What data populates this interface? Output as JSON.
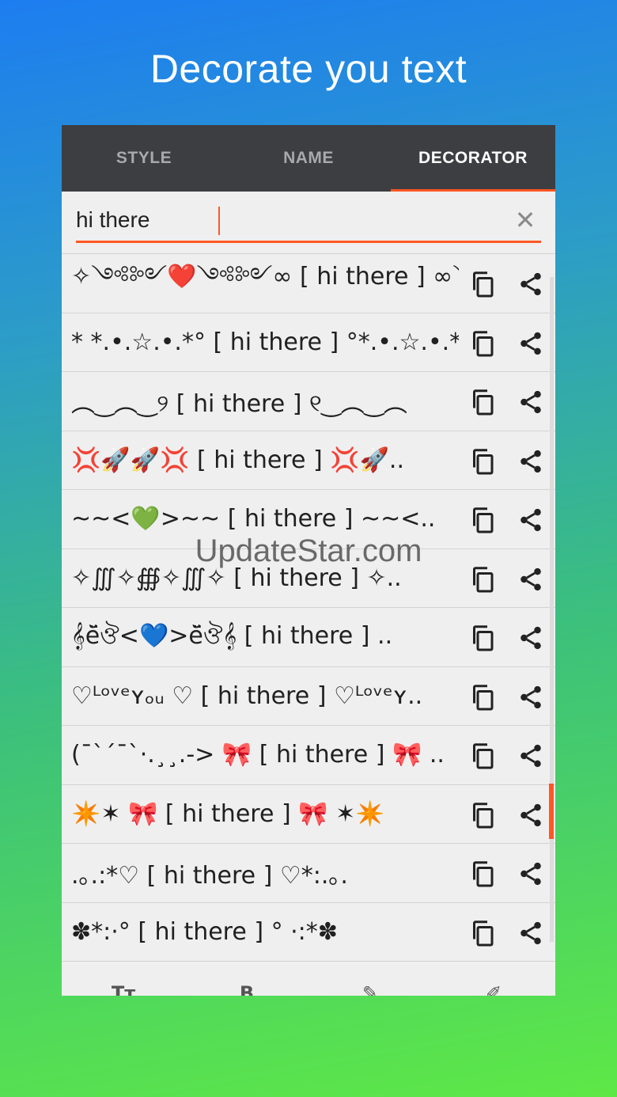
{
  "headline": "Decorate you text",
  "tabs": [
    {
      "label": "STYLE",
      "active": false
    },
    {
      "label": "NAME",
      "active": false
    },
    {
      "label": "DECORATOR",
      "active": true
    }
  ],
  "search": {
    "value": "hi there",
    "clear_icon": "close-icon"
  },
  "rows": [
    "✧༺༻❤️༺༻∞ [ hi there ] ∞༺༻..",
    "* *.•.☆.•.*°  [ hi there ] °*.•.☆.•.*° *",
    "︵‿︵‿୨ [ hi there ] ୧‿︵‿︵",
    "💢🚀🚀💢 [ hi there ] 💢🚀..",
    "~~<💚>~~ [ hi there ] ~~<..",
    "✧∭✧∰✧∭✧ [ hi there ] ✧..",
    "𝄞ĕ̈ঔ<💙>ĕ̈ঔ𝄞 [ hi there ] ..",
    "♡ᴸᵒᵛᵉʏₒᵤ ♡ [ hi there ] ♡ᴸᵒᵛᵉʏ..",
    "(¯`´¯`·.¸¸.->  🎀 [ hi there ] 🎀  ..",
    "✴️✶  🎀 [ hi there ] 🎀  ✶✴️",
    ".｡.:*♡ [ hi there ] ♡*:.｡.",
    "✽*:·° [ hi there ] ° ·:*✽"
  ],
  "row_actions": {
    "copy_icon": "copy-icon",
    "share_icon": "share-icon"
  },
  "bottom_nav": [
    "Tт",
    "B",
    "✎",
    "✐"
  ],
  "watermark": "UpdateStar.com",
  "colors": {
    "accent": "#ff5722",
    "tabbar": "#3d3e42",
    "list_bg": "#efefef"
  }
}
